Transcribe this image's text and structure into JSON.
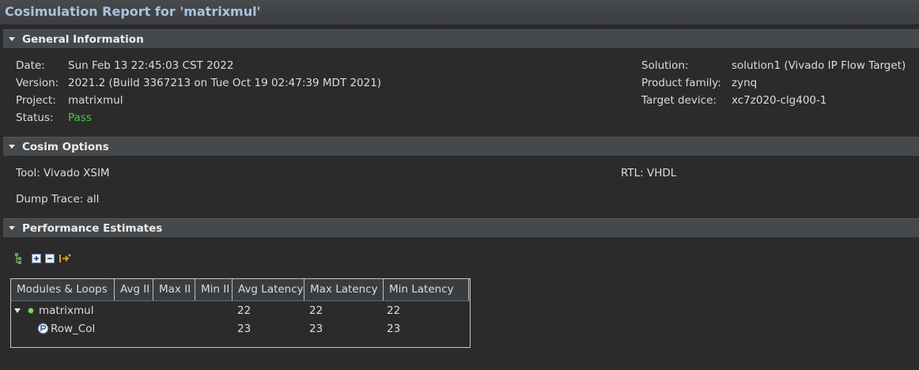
{
  "window": {
    "title": "Cosimulation Report for 'matrixmul'"
  },
  "general_info": {
    "header": "General Information",
    "left": [
      {
        "label": "Date:",
        "value": "Sun Feb 13 22:45:03 CST 2022"
      },
      {
        "label": "Version:",
        "value": "2021.2 (Build 3367213 on Tue Oct 19 02:47:39 MDT 2021)"
      },
      {
        "label": "Project:",
        "value": "matrixmul"
      },
      {
        "label": "Status:",
        "value": "Pass"
      }
    ],
    "right": [
      {
        "label": "Solution:",
        "value": "solution1 (Vivado IP Flow Target)"
      },
      {
        "label": "Product family:",
        "value": "zynq"
      },
      {
        "label": "Target device:",
        "value": "xc7z020-clg400-1"
      }
    ]
  },
  "cosim_options": {
    "header": "Cosim Options",
    "tool": "Tool: Vivado XSIM",
    "rtl": "RTL: VHDL",
    "dump_trace": "Dump Trace: all"
  },
  "performance": {
    "header": "Performance Estimates",
    "toolbar_icons": [
      "tree-toggle-icon",
      "expand-all-icon",
      "collapse-all-icon",
      "goto-source-icon"
    ],
    "columns": [
      "Modules & Loops",
      "Avg II",
      "Max II",
      "Min II",
      "Avg Latency",
      "Max Latency",
      "Min Latency"
    ],
    "rows": [
      {
        "name": "matrixmul",
        "avg_ii": "",
        "max_ii": "",
        "min_ii": "",
        "avg_latency": "22",
        "max_latency": "22",
        "min_latency": "22",
        "icon": "module-dot-icon"
      },
      {
        "name": "Row_Col",
        "avg_ii": "",
        "max_ii": "",
        "min_ii": "",
        "avg_latency": "23",
        "max_latency": "23",
        "min_latency": "23",
        "icon": "loop-icon"
      }
    ]
  },
  "colors": {
    "pass": "#3ad33a",
    "title": "#a9c4de",
    "background": "#2b2b2c"
  }
}
